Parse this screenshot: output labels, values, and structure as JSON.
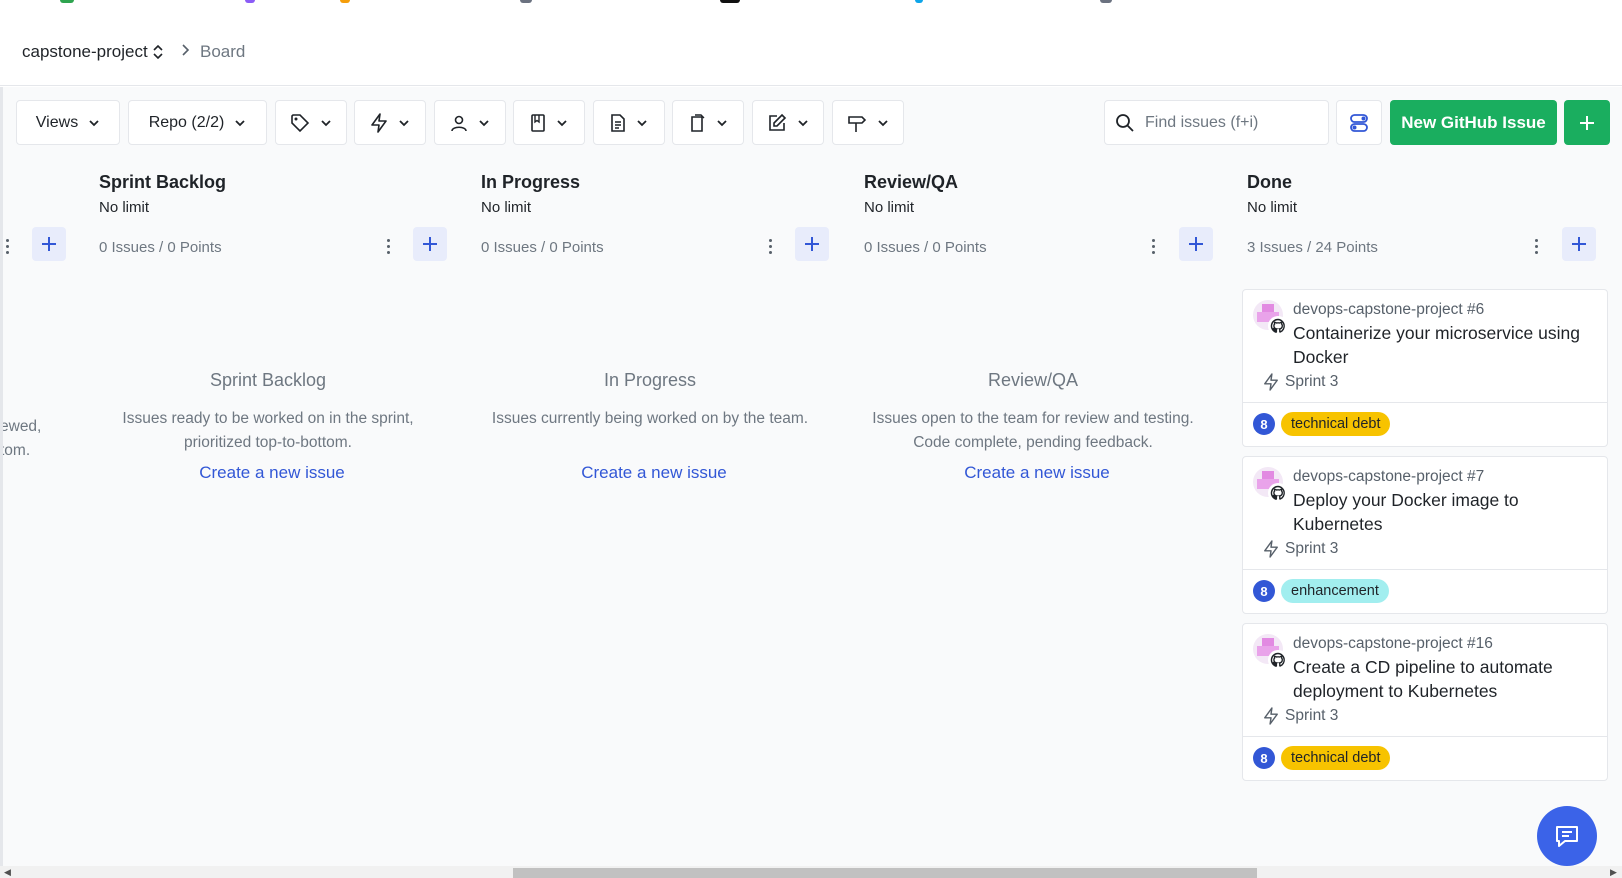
{
  "breadcrumb": {
    "repo": "capstone-project",
    "separator": ">",
    "current": "Board"
  },
  "toolbar": {
    "views_label": "Views",
    "repo_label": "Repo (2/2)",
    "filter_icons": [
      "tag-icon",
      "bolt-icon",
      "person-icon",
      "milestone-icon",
      "document-icon",
      "clipboard-icon",
      "edit-icon",
      "signpost-icon"
    ],
    "search_placeholder": "Find issues (f+i)",
    "new_issue_label": "New GitHub Issue"
  },
  "partial_column": {
    "line1": "ewed,",
    "line2": "tom."
  },
  "columns": [
    {
      "title": "Sprint Backlog",
      "limit": "No limit",
      "count": "0 Issues / 0 Points",
      "empty_title": "Sprint Backlog",
      "empty_desc": "Issues ready to be worked on in the sprint, prioritized top-to-bottom.",
      "empty_link": "Create a new issue"
    },
    {
      "title": "In Progress",
      "limit": "No limit",
      "count": "0 Issues / 0 Points",
      "empty_title": "In Progress",
      "empty_desc": "Issues currently being worked on by the team.",
      "empty_link": "Create a new issue"
    },
    {
      "title": "Review/QA",
      "limit": "No limit",
      "count": "0 Issues / 0 Points",
      "empty_title": "Review/QA",
      "empty_desc": "Issues open to the team for review and testing. Code complete, pending feedback.",
      "empty_link": "Create a new issue"
    },
    {
      "title": "Done",
      "limit": "No limit",
      "count": "3 Issues / 24 Points",
      "cards": [
        {
          "repo": "devops-capstone-project #6",
          "title": "Containerize your microservice using Docker",
          "sprint": "Sprint 3",
          "points": "8",
          "label": "technical debt",
          "label_color": "#f7c300"
        },
        {
          "repo": "devops-capstone-project #7",
          "title": "Deploy your Docker image to Kubernetes",
          "sprint": "Sprint 3",
          "points": "8",
          "label": "enhancement",
          "label_color": "#a2eeef"
        },
        {
          "repo": "devops-capstone-project #16",
          "title": "Create a CD pipeline to automate deployment to Kubernetes",
          "sprint": "Sprint 3",
          "points": "8",
          "label": "technical debt",
          "label_color": "#f7c300"
        }
      ]
    }
  ],
  "colors": {
    "primary_green": "#1aae5f",
    "accent_blue": "#3257d6",
    "chat_blue": "#3b63e8"
  }
}
